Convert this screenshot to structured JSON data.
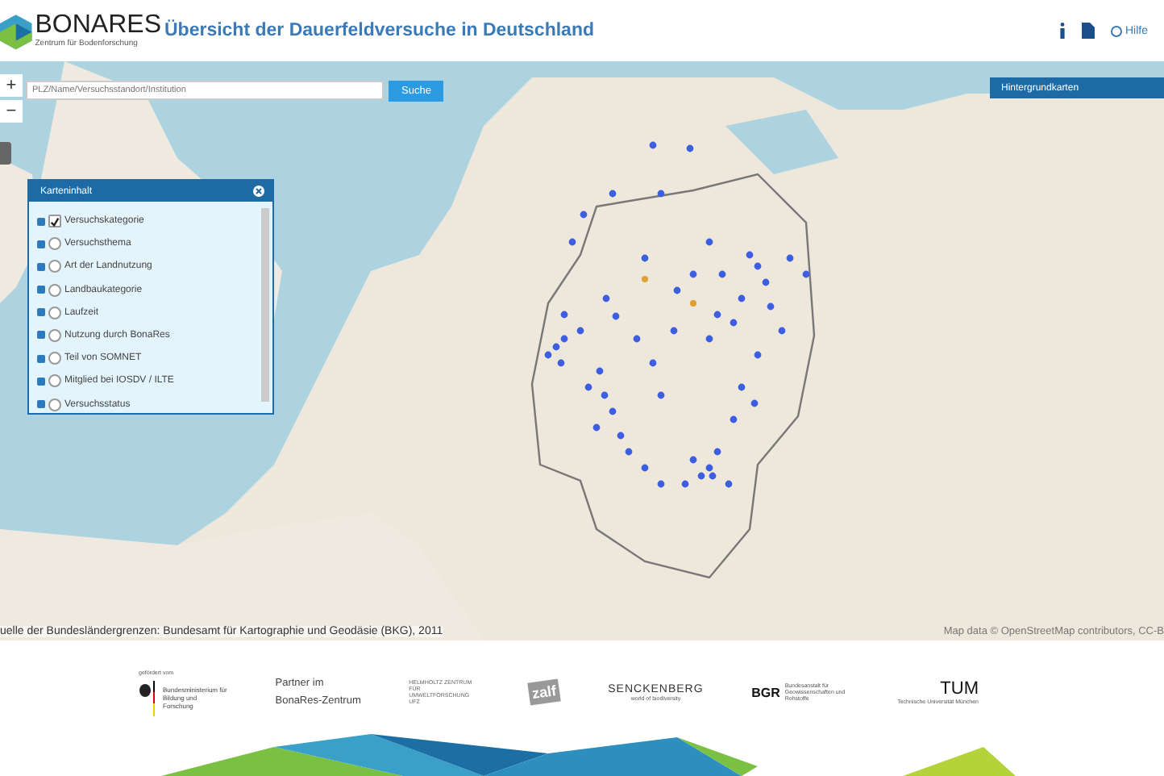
{
  "header": {
    "logo": {
      "name": "BONARES",
      "subtitle": "Zentrum für Bodenforschung"
    },
    "title": "Übersicht der Dauerfeldversuche in Deutschland",
    "help": "Hilfe"
  },
  "map": {
    "zoom_in": "+",
    "zoom_out": "−",
    "search": {
      "placeholder": "PLZ/Name/Versuchsstandort/Institution",
      "button": "Suche"
    },
    "panel": {
      "title": "Karteninhalt",
      "items": [
        {
          "label": "Versuchskategorie",
          "checked": true
        },
        {
          "label": "Versuchsthema",
          "checked": false
        },
        {
          "label": "Art der Landnutzung",
          "checked": false
        },
        {
          "label": "Landbaukategorie",
          "checked": false
        },
        {
          "label": "Laufzeit",
          "checked": false
        },
        {
          "label": "Nutzung durch BonaRes",
          "checked": false
        },
        {
          "label": "Teil von SOMNET",
          "checked": false
        },
        {
          "label": "Mitglied bei IOSDV / ILTE",
          "checked": false
        },
        {
          "label": "Versuchsstatus",
          "checked": false
        }
      ]
    },
    "basemaps_button": "Hintergrundkarten",
    "source_note": "uelle der Bundesländergrenzen: Bundesamt für Kartographie und Geodäsie (BKG), 2011",
    "attribution": "Map data © OpenStreetMap contributors, CC-B"
  },
  "footer": {
    "funded_by": "gefördert vom",
    "ministry": "Bundesministerium für Bildung und Forschung",
    "partner_lines": [
      "Partner im",
      "BonaRes-Zentrum"
    ],
    "partners": [
      {
        "kind": "ufz",
        "text": "HELMHOLTZ ZENTRUM FÜR UMWELTFORSCHUNG UFZ"
      },
      {
        "kind": "zalf",
        "text": "zalf"
      },
      {
        "kind": "senckenberg",
        "text": "SENCKENBERG",
        "sub": "world of biodiversity"
      },
      {
        "kind": "bgr",
        "text": "BGR",
        "sub": "Bundesanstalt für Geowissenschaften und Rohstoffe"
      },
      {
        "kind": "tum",
        "text": "TUM",
        "sub": "Technische Universität München"
      }
    ]
  }
}
